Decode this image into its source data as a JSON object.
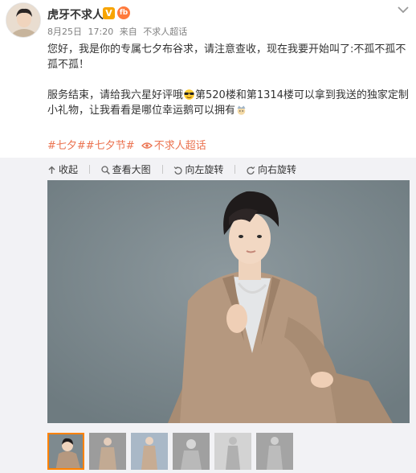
{
  "user": {
    "name": "虎牙不求人",
    "vip_badge": "V",
    "level_badge": "fb"
  },
  "meta": {
    "date": "8月25日",
    "time": "17:20",
    "source_prefix": "来自",
    "source": "不求人超话"
  },
  "post": {
    "paragraph1": "您好，我是你的专属七夕布谷求，请注意查收，现在我要开始叫了:不孤不孤不孤不孤！",
    "paragraph2_a": "服务结束，请给我六星好评哦",
    "paragraph2_b": "第520楼和第1314楼可以拿到我送的独家定制小礼物，让我看看是哪位幸运鹅可以拥有",
    "tags": [
      "#七夕#",
      "#七夕节#"
    ],
    "super_topic": "不求人超话"
  },
  "toolbar": {
    "collapse": "收起",
    "view_large": "查看大图",
    "rotate_left": "向左旋转",
    "rotate_right": "向右旋转"
  },
  "thumbnails": {
    "count": 6,
    "active_index": 0
  },
  "colors": {
    "accent": "#eb7350",
    "thumb_border": "#ff8200",
    "panel_bg": "#f2f2f5",
    "photo_bg": "#7f8c91",
    "suit": "#b5987f"
  },
  "icons": [
    "chevron-down-icon",
    "vip-icon",
    "level-icon",
    "sunglasses-emoji-icon",
    "crown-emoji-icon",
    "super-topic-icon",
    "collapse-icon",
    "zoom-icon",
    "rotate-left-icon",
    "rotate-right-icon"
  ]
}
